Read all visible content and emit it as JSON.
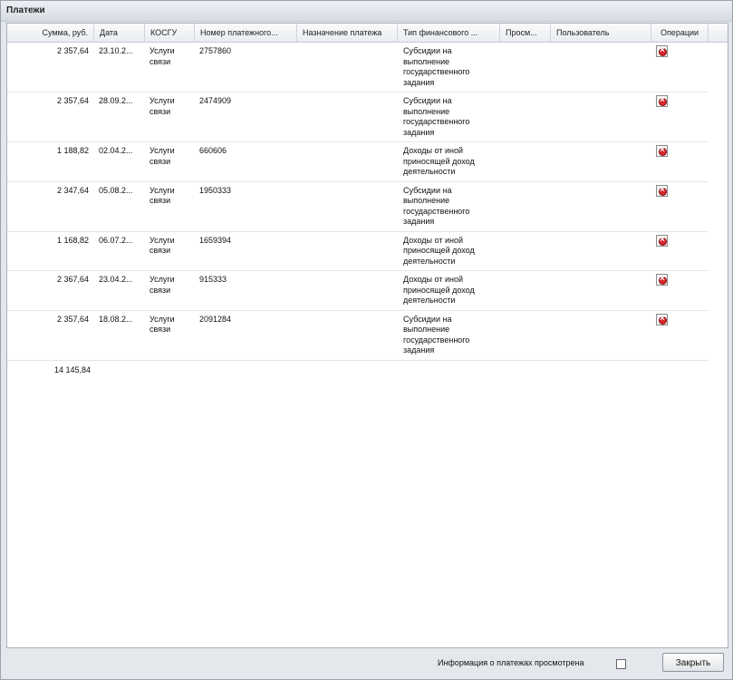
{
  "window": {
    "title": "Платежи"
  },
  "columns": [
    {
      "label": "Сумма, руб.",
      "name": "col-amount"
    },
    {
      "label": "Дата",
      "name": "col-date"
    },
    {
      "label": "КОСГУ",
      "name": "col-kosgu"
    },
    {
      "label": "Номер платежного...",
      "name": "col-payment-number"
    },
    {
      "label": "Назначение платежа",
      "name": "col-purpose"
    },
    {
      "label": "Тип финансового ...",
      "name": "col-finance-type"
    },
    {
      "label": "Просм...",
      "name": "col-viewed"
    },
    {
      "label": "Пользователь",
      "name": "col-user"
    },
    {
      "label": "Операции",
      "name": "col-operations"
    }
  ],
  "rows": [
    {
      "amount": "2 357,64",
      "date": "23.10.2...",
      "kosgu": "Услуги\nсвязи",
      "number": "2757860",
      "purpose": "",
      "type": "Субсидии на\nвыполнение\nгосударственного\nзадания",
      "viewed": "",
      "user": ""
    },
    {
      "amount": "2 357,64",
      "date": "28.09.2...",
      "kosgu": "Услуги\nсвязи",
      "number": "2474909",
      "purpose": "",
      "type": "Субсидии на\nвыполнение\nгосударственного\nзадания",
      "viewed": "",
      "user": ""
    },
    {
      "amount": "1 188,82",
      "date": "02.04.2...",
      "kosgu": "Услуги\nсвязи",
      "number": "660606",
      "purpose": "",
      "type": "Доходы от иной\nприносящей доход\nдеятельности",
      "viewed": "",
      "user": ""
    },
    {
      "amount": "2 347,64",
      "date": "05.08.2...",
      "kosgu": "Услуги\nсвязи",
      "number": "1950333",
      "purpose": "",
      "type": "Субсидии на\nвыполнение\nгосударственного\nзадания",
      "viewed": "",
      "user": ""
    },
    {
      "amount": "1 168,82",
      "date": "06.07.2...",
      "kosgu": "Услуги\nсвязи",
      "number": "1659394",
      "purpose": "",
      "type": "Доходы от иной\nприносящей доход\nдеятельности",
      "viewed": "",
      "user": ""
    },
    {
      "amount": "2 367,64",
      "date": "23.04.2...",
      "kosgu": "Услуги\nсвязи",
      "number": "915333",
      "purpose": "",
      "type": "Доходы от иной\nприносящей доход\nдеятельности",
      "viewed": "",
      "user": ""
    },
    {
      "amount": "2 357,64",
      "date": "18.08.2...",
      "kosgu": "Услуги\nсвязи",
      "number": "2091284",
      "purpose": "",
      "type": "Субсидии на\nвыполнение\nгосударственного\nзадания",
      "viewed": "",
      "user": ""
    }
  ],
  "summary": {
    "total": "14 145,84"
  },
  "footer": {
    "confirm_label": "Информация о платежах просмотрена",
    "confirm_checked": false,
    "close_label": "Закрыть"
  },
  "icons": {
    "row_action": "delete-icon"
  },
  "colors": {
    "delete_icon": "#d8262b"
  }
}
